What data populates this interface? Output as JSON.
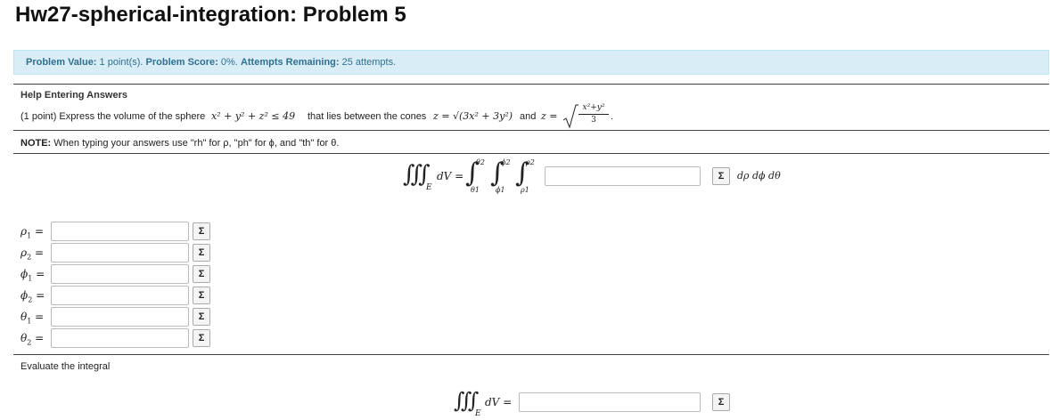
{
  "page": {
    "title": "Hw27-spherical-integration: Problem 5"
  },
  "info_bar": {
    "value_label": "Problem Value:",
    "value_text": "1 point(s).",
    "score_label": "Problem Score:",
    "score_text": "0%.",
    "attempts_label": "Attempts Remaining:",
    "attempts_text": "25 attempts."
  },
  "problem": {
    "help_link": "Help Entering Answers",
    "prefix": "(1 point) Express the volume of the sphere",
    "sphere_ineq": "x² + y² + z² ≤ 49",
    "middle": "that lies between the cones",
    "cone1": "z = √(3x² + 3y²)",
    "and_text": "and",
    "cone2_lhs": "z =",
    "cone2_num": "x²+y²",
    "cone2_den": "3",
    "end": ".",
    "note_label": "NOTE:",
    "note_text": "When typing your answers use \"rh\" for ρ, \"ph\" for ϕ, and \"th\" for θ."
  },
  "integral_setup": {
    "triple_integral_symbol": "∭",
    "region": "E",
    "dv_eq": "dV =",
    "integral_symbol": "∫",
    "upper_bounds": [
      "θ2",
      "ϕ2",
      "ρ2"
    ],
    "lower_bounds": [
      "θ1",
      "ϕ1",
      "ρ1"
    ],
    "differentials": "dρ dϕ dθ",
    "answer_value": ""
  },
  "bounds": [
    {
      "symbol": "ρ",
      "sub": "1",
      "eq": "=",
      "value": ""
    },
    {
      "symbol": "ρ",
      "sub": "2",
      "eq": "=",
      "value": ""
    },
    {
      "symbol": "ϕ",
      "sub": "1",
      "eq": "=",
      "value": ""
    },
    {
      "symbol": "ϕ",
      "sub": "2",
      "eq": "=",
      "value": ""
    },
    {
      "symbol": "θ",
      "sub": "1",
      "eq": "=",
      "value": ""
    },
    {
      "symbol": "θ",
      "sub": "2",
      "eq": "=",
      "value": ""
    }
  ],
  "evaluate": {
    "label": "Evaluate the integral",
    "triple_integral_symbol": "∭",
    "region": "E",
    "dv_eq": "dV =",
    "answer_value": ""
  },
  "sigma_label": "Σ"
}
